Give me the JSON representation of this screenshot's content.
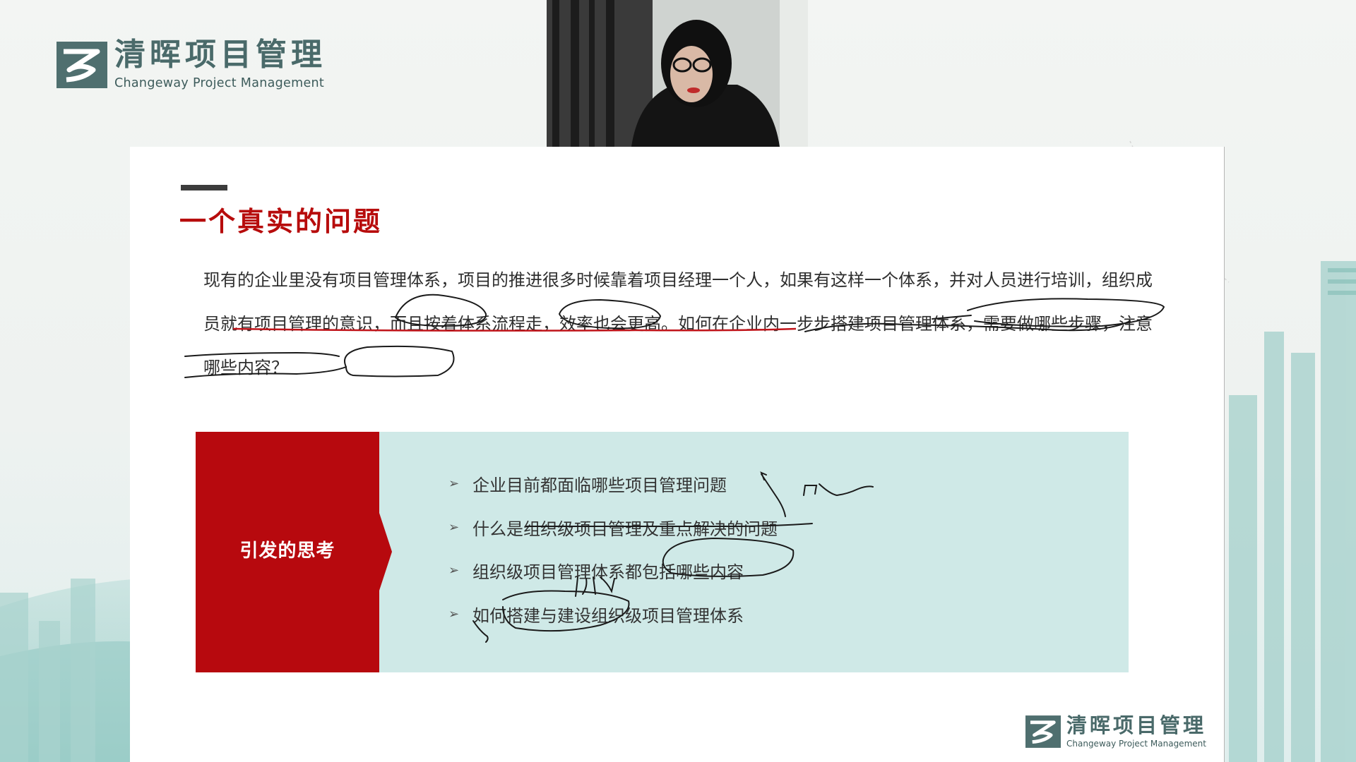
{
  "logo": {
    "name_cn": "清晖项目管理",
    "name_en": "Changeway Project Management"
  },
  "slide": {
    "title": "一个真实的问题",
    "paragraph": "现有的企业里没有项目管理体系，项目的推进很多时候靠着项目经理一个人，如果有这样一个体系，并对人员进行培训，组织成员就有项目管理的意识，而且按着体系流程走，效率也会更高。如何在企业内一步步搭建项目管理体系，需要做哪些步骤，注意哪些内容？",
    "reflection": {
      "label": "引发的思考",
      "items": [
        "企业目前都面临哪些项目管理问题",
        "什么是组织级项目管理及重点解决的问题",
        "组织级项目管理体系都包括哪些内容",
        "如何搭建与建设组织级项目管理体系"
      ]
    }
  },
  "colors": {
    "accent_red": "#b7090e",
    "title_red": "#b70c0c",
    "panel_teal": "#cfe9e7",
    "logo_teal": "#4a6a6a"
  }
}
